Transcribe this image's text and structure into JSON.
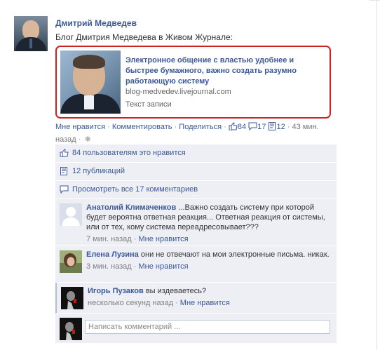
{
  "post": {
    "author": "Дмитрий Медведев",
    "text": "Блог Дмитрия Медведева в Живом Журнале:",
    "attachment": {
      "title": "Электронное общение с властью удобнее и быстрее бумажного, важно создать разумно работающую систему",
      "domain": "blog-medvedev.livejournal.com",
      "description": "Текст записи"
    },
    "actions": {
      "like": "Мне нравится",
      "comment": "Комментировать",
      "share": "Поделиться",
      "likes_count": "84",
      "comments_count": "17",
      "shares_count": "12",
      "time": "43 мин. назад"
    }
  },
  "ufi": {
    "likes_text": "84 пользователям это нравится",
    "shares_text": "12 публикаций",
    "view_all_text": "Просмотреть все 17 комментариев"
  },
  "comments": [
    {
      "author": "Анатолий Климаченков",
      "text": "...Важно создать систему при которой будет вероятна ответная реакция... Ответная реакция от системы, или от тех, кому система переадресовывает???",
      "time": "7 мин. назад",
      "like": "Мне нравится"
    },
    {
      "author": "Елена Лузина",
      "text": "они не отвечают на мои электронные письма. никак.",
      "time": "3 мин. назад",
      "like": "Мне нравится"
    },
    {
      "author": "Игорь Пузаков",
      "text": "вы издеваетесь?",
      "time": "несколько секунд назад",
      "like": "Мне нравится"
    }
  ],
  "composer": {
    "placeholder": "Написать комментарий ..."
  },
  "colors": {
    "link": "#3b5998",
    "ufi_background": "#edeff4",
    "highlight_border": "#cc2222"
  }
}
